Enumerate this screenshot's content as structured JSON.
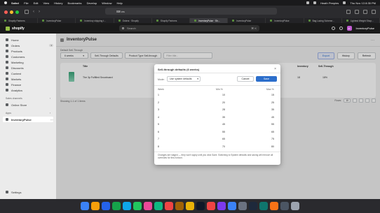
{
  "menubar": {
    "app": "Safari",
    "items": [
      "File",
      "Edit",
      "View",
      "History",
      "Bookmarks",
      "Develop",
      "Window",
      "Help"
    ],
    "user": "Heath Peeples",
    "clock": "Thu Nov 13  8:35 PM"
  },
  "browser": {
    "url": "⌨ ws"
  },
  "tabs": [
    {
      "label": "Shopify Partners"
    },
    {
      "label": "InventoryPulse"
    },
    {
      "label": "Inventory shipping t..."
    },
    {
      "label": "Orders · Shopify"
    },
    {
      "label": "Shopify Partners"
    },
    {
      "label": "InventoryPulse · Sh..."
    },
    {
      "label": "InventoryPulse"
    },
    {
      "label": "InventoryPulse"
    },
    {
      "label": "Bag Lacing Scheme..."
    },
    {
      "label": "Lightest Weight Shop..."
    }
  ],
  "shopify": {
    "logo": "shopify",
    "search_placeholder": "Search",
    "shortcut": "⌘ K",
    "store_initials": "IP",
    "store_name": "InventoryPulse"
  },
  "sidebar": {
    "items": [
      {
        "label": "Home"
      },
      {
        "label": "Orders",
        "badge": "1"
      },
      {
        "label": "Products"
      },
      {
        "label": "Customers"
      },
      {
        "label": "Marketing"
      },
      {
        "label": "Discounts"
      },
      {
        "label": "Content"
      },
      {
        "label": "Markets"
      },
      {
        "label": "Finance"
      },
      {
        "label": "Analytics"
      }
    ],
    "sales_channels_label": "Sales channels",
    "online_store": "Online Store",
    "apps_label": "Apps",
    "app_selected": "InventoryPulse",
    "settings": "Settings"
  },
  "app": {
    "title": "InventoryPulse",
    "default_sell_through_label": "Default Sell-Through",
    "weeks_select": "6 weeks",
    "sell_through_defaults_btn": "Sell-Through Defaults",
    "product_type_btn": "Product Type Sell-through",
    "filter_placeholder": "Filter title...",
    "export_btn": "Export",
    "history_btn": "History",
    "refresh_btn": "Refresh",
    "columns": [
      "Title",
      "Inventory",
      "Sell-Through"
    ],
    "rows": [
      {
        "title": "The 3p Fulfilled Snowboard",
        "price": "$59.90",
        "inventory": "18",
        "sell_through": "18%"
      }
    ],
    "footer": "Showing 1-1 of 1 items",
    "rows_label": "Rows:",
    "rows_value": "10"
  },
  "modal": {
    "title": "Sell-through defaults (6 weeks)",
    "close": "×",
    "mode_label": "Mode:",
    "mode_value": "Use system defaults",
    "cancel": "Cancel",
    "save": "Save",
    "headers": {
      "week": "Week",
      "min": "Min %",
      "max": "Max %"
    },
    "rows": [
      {
        "week": "1",
        "min": "10",
        "max": "15"
      },
      {
        "week": "2",
        "min": "20",
        "max": "25"
      },
      {
        "week": "3",
        "min": "28",
        "max": "35"
      },
      {
        "week": "4",
        "min": "35",
        "max": "45"
      },
      {
        "week": "5",
        "min": "45",
        "max": "55"
      },
      {
        "week": "6",
        "min": "55",
        "max": "65"
      },
      {
        "week": "7",
        "min": "65",
        "max": "75"
      },
      {
        "week": "8",
        "min": "70",
        "max": "80"
      }
    ],
    "note": "Changes are staged — they won't apply until you click Save. Switching to System defaults and saving will remove all overrides for this horizon."
  },
  "colors": {
    "primary": "#2c6ecb",
    "shopify_green": "#95bf47",
    "topbar": "#1a1a1a"
  }
}
